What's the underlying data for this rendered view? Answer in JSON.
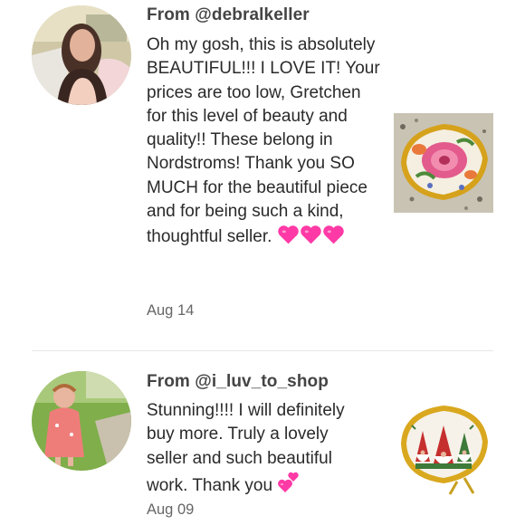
{
  "reviews": [
    {
      "from": "From @debralkeller",
      "text": "Oh my gosh, this is absolutely BEAUTIFUL!!! I LOVE IT! Your prices are too low, Gretchen for this level of beauty and quality!! These belong in Nordstroms! Thank you SO MUCH for the beautiful piece and for being such a kind, thoughtful seller.",
      "emoji": "heart-heart-heart",
      "date": "Aug 14"
    },
    {
      "from": "From @i_luv_to_shop",
      "text": "Stunning!!!! I will definitely buy more. Truly a lovely seller and such beautiful work. Thank you",
      "emoji": "two-hearts",
      "date": "Aug 09"
    }
  ],
  "colors": {
    "heart": "#ff3aa6",
    "divider": "#e6e6e6"
  }
}
